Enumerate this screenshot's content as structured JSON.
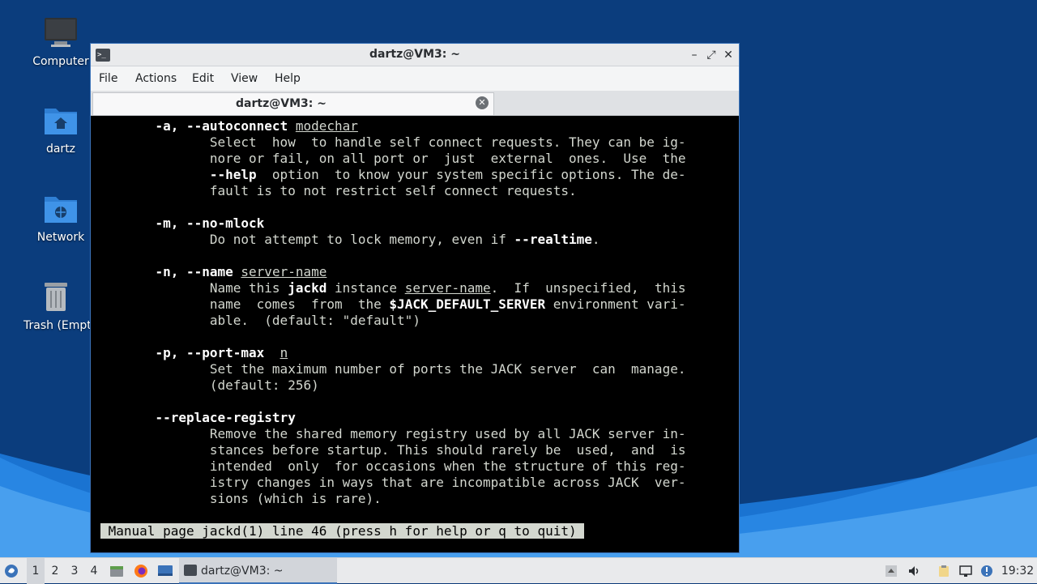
{
  "desktop": {
    "icons": [
      {
        "label": "Computer",
        "icon": "computer-icon"
      },
      {
        "label": "dartz",
        "icon": "home-folder-icon"
      },
      {
        "label": "Network",
        "icon": "network-folder-icon"
      },
      {
        "label": "Trash (Empty)",
        "icon": "trash-icon"
      }
    ]
  },
  "window": {
    "title": "dartz@VM3: ~",
    "controls": {
      "minimize": "–",
      "maximize": "⤢",
      "close": "✕"
    },
    "menu": [
      "File",
      "Actions",
      "Edit",
      "View",
      "Help"
    ],
    "tab": {
      "label": "dartz@VM3: ~",
      "close": "✕"
    }
  },
  "terminal": {
    "lines": [
      {
        "segments": [
          {
            "t": "       "
          },
          {
            "t": "-a, --autoconnect",
            "b": true
          },
          {
            "t": " "
          },
          {
            "t": "modechar",
            "u": true
          }
        ]
      },
      {
        "segments": [
          {
            "t": "              Select  how  to handle self connect requests. They can be ig-"
          }
        ]
      },
      {
        "segments": [
          {
            "t": "              nore or fail, on all port or  just  external  ones.  Use  the"
          }
        ]
      },
      {
        "segments": [
          {
            "t": "              "
          },
          {
            "t": "--help",
            "b": true
          },
          {
            "t": "  option  to know your system specific options. The de-"
          }
        ]
      },
      {
        "segments": [
          {
            "t": "              fault is to not restrict self connect requests."
          }
        ]
      },
      {
        "segments": [
          {
            "t": ""
          }
        ]
      },
      {
        "segments": [
          {
            "t": "       "
          },
          {
            "t": "-m, --no-mlock",
            "b": true
          }
        ]
      },
      {
        "segments": [
          {
            "t": "              Do not attempt to lock memory, even if "
          },
          {
            "t": "--realtime",
            "b": true
          },
          {
            "t": "."
          }
        ]
      },
      {
        "segments": [
          {
            "t": ""
          }
        ]
      },
      {
        "segments": [
          {
            "t": "       "
          },
          {
            "t": "-n, --name",
            "b": true
          },
          {
            "t": " "
          },
          {
            "t": "server-name",
            "u": true
          }
        ]
      },
      {
        "segments": [
          {
            "t": "              Name this "
          },
          {
            "t": "jackd",
            "b": true
          },
          {
            "t": " instance "
          },
          {
            "t": "server-name",
            "u": true
          },
          {
            "t": ".  If  unspecified,  this"
          }
        ]
      },
      {
        "segments": [
          {
            "t": "              name  comes  from  the "
          },
          {
            "t": "$JACK_DEFAULT_SERVER",
            "b": true
          },
          {
            "t": " environment vari-"
          }
        ]
      },
      {
        "segments": [
          {
            "t": "              able.  (default: \"default\")"
          }
        ]
      },
      {
        "segments": [
          {
            "t": ""
          }
        ]
      },
      {
        "segments": [
          {
            "t": "       "
          },
          {
            "t": "-p, --port-max",
            "b": true
          },
          {
            "t": "  "
          },
          {
            "t": "n",
            "u": true
          }
        ]
      },
      {
        "segments": [
          {
            "t": "              Set the maximum number of ports the JACK server  can  manage."
          }
        ]
      },
      {
        "segments": [
          {
            "t": "              (default: 256)"
          }
        ]
      },
      {
        "segments": [
          {
            "t": ""
          }
        ]
      },
      {
        "segments": [
          {
            "t": "       "
          },
          {
            "t": "--replace-registry",
            "b": true
          }
        ]
      },
      {
        "segments": [
          {
            "t": "              Remove the shared memory registry used by all JACK server in-"
          }
        ]
      },
      {
        "segments": [
          {
            "t": "              stances before startup. This should rarely be  used,  and  is"
          }
        ]
      },
      {
        "segments": [
          {
            "t": "              intended  only  for occasions when the structure of this reg-"
          }
        ]
      },
      {
        "segments": [
          {
            "t": "              istry changes in ways that are incompatible across JACK  ver-"
          }
        ]
      },
      {
        "segments": [
          {
            "t": "              sions (which is rare)."
          }
        ]
      },
      {
        "segments": [
          {
            "t": ""
          }
        ]
      }
    ],
    "status": " Manual page jackd(1) line 46 (press h for help or q to quit) "
  },
  "taskbar": {
    "workspaces": [
      "1",
      "2",
      "3",
      "4"
    ],
    "active_workspace": 0,
    "task_label": "dartz@VM3: ~",
    "clock": "19:32",
    "launchers": [
      "file-manager-icon",
      "firefox-icon",
      "desktop-icon"
    ],
    "tray": [
      "tray-arrow-icon",
      "volume-icon",
      "clipboard-icon",
      "network-icon",
      "update-notifier-icon"
    ]
  },
  "colors": {
    "accent": "#3b73b9",
    "terminal_bg": "#000000",
    "terminal_fg": "#d3d7cf"
  }
}
